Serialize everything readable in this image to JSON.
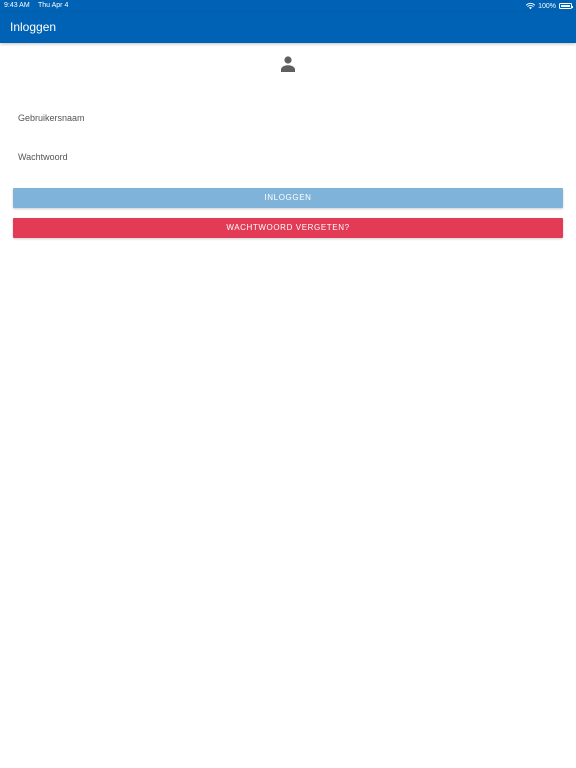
{
  "statusbar": {
    "time": "9:43 AM",
    "date": "Thu Apr 4",
    "battery": "100%",
    "battery_level": 1.0,
    "wifi_icon": "wifi-icon",
    "battery_icon": "battery-icon"
  },
  "appbar": {
    "title": "Inloggen"
  },
  "avatar": {
    "icon": "person-icon"
  },
  "form": {
    "username_label": "Gebruikersnaam",
    "username_value": "",
    "password_label": "Wachtwoord",
    "password_value": ""
  },
  "buttons": {
    "login_label": "INLOGGEN",
    "forgot_label": "WACHTWOORD VERGETEN?"
  },
  "colors": {
    "primary": "#0062b4",
    "login_button": "#80b3da",
    "forgot_button": "#e33b56",
    "icon": "#5f5f5f"
  }
}
